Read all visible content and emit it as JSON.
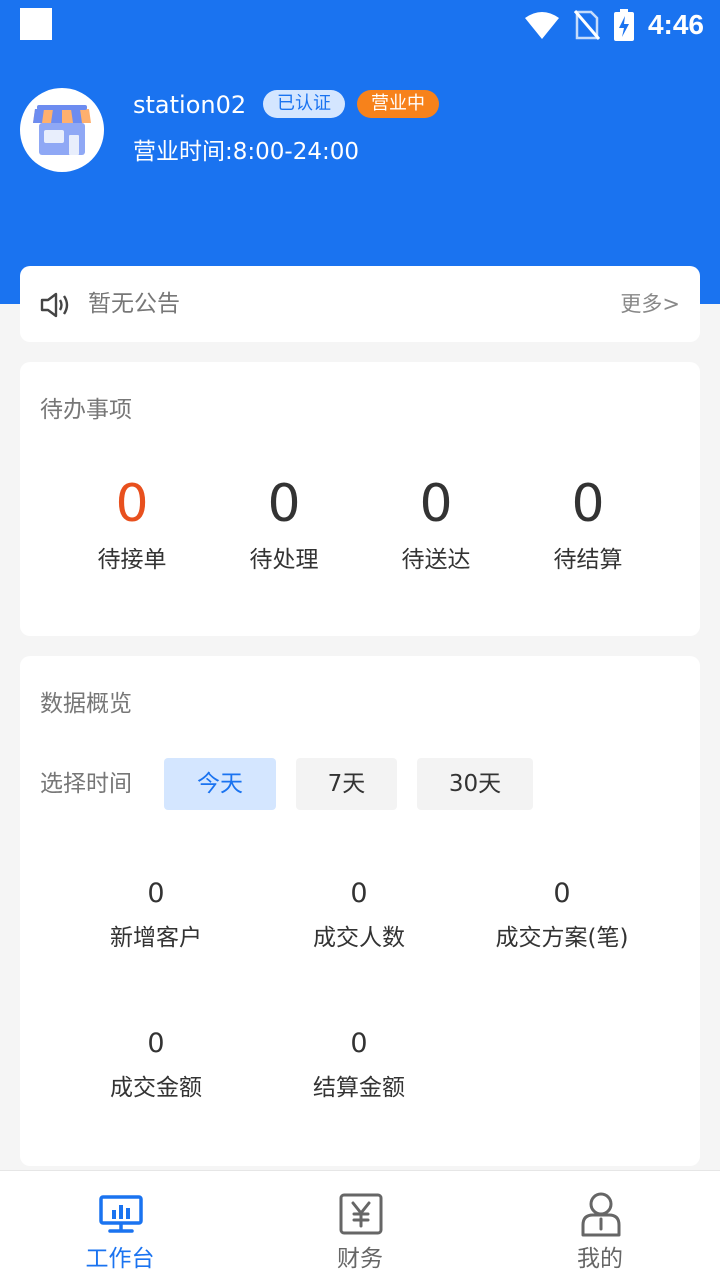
{
  "status_bar": {
    "time": "4:46"
  },
  "store": {
    "name": "station02",
    "badge_verified": "已认证",
    "badge_open": "营业中",
    "hours": "营业时间:8:00-24:00"
  },
  "notice": {
    "icon": "speaker-icon",
    "text": "暂无公告",
    "more": "更多>"
  },
  "todo": {
    "title": "待办事项",
    "items": [
      {
        "count": "0",
        "label": "待接单"
      },
      {
        "count": "0",
        "label": "待处理"
      },
      {
        "count": "0",
        "label": "待送达"
      },
      {
        "count": "0",
        "label": "待结算"
      }
    ]
  },
  "overview": {
    "title": "数据概览",
    "time_label": "选择时间",
    "time_options": [
      "今天",
      "7天",
      "30天"
    ],
    "selected_option": "今天",
    "stats": [
      {
        "value": "0",
        "label": "新增客户"
      },
      {
        "value": "0",
        "label": "成交人数"
      },
      {
        "value": "0",
        "label": "成交方案(笔)"
      },
      {
        "value": "0",
        "label": "成交金额"
      },
      {
        "value": "0",
        "label": "结算金额"
      }
    ]
  },
  "tabbar": {
    "items": [
      {
        "label": "工作台",
        "icon": "monitor-chart-icon",
        "active": true
      },
      {
        "label": "财务",
        "icon": "yen-icon",
        "active": false
      },
      {
        "label": "我的",
        "icon": "person-icon",
        "active": false
      }
    ]
  },
  "colors": {
    "primary": "#1a73f0",
    "accent_orange": "#e8501e",
    "badge_orange": "#f7821b"
  }
}
